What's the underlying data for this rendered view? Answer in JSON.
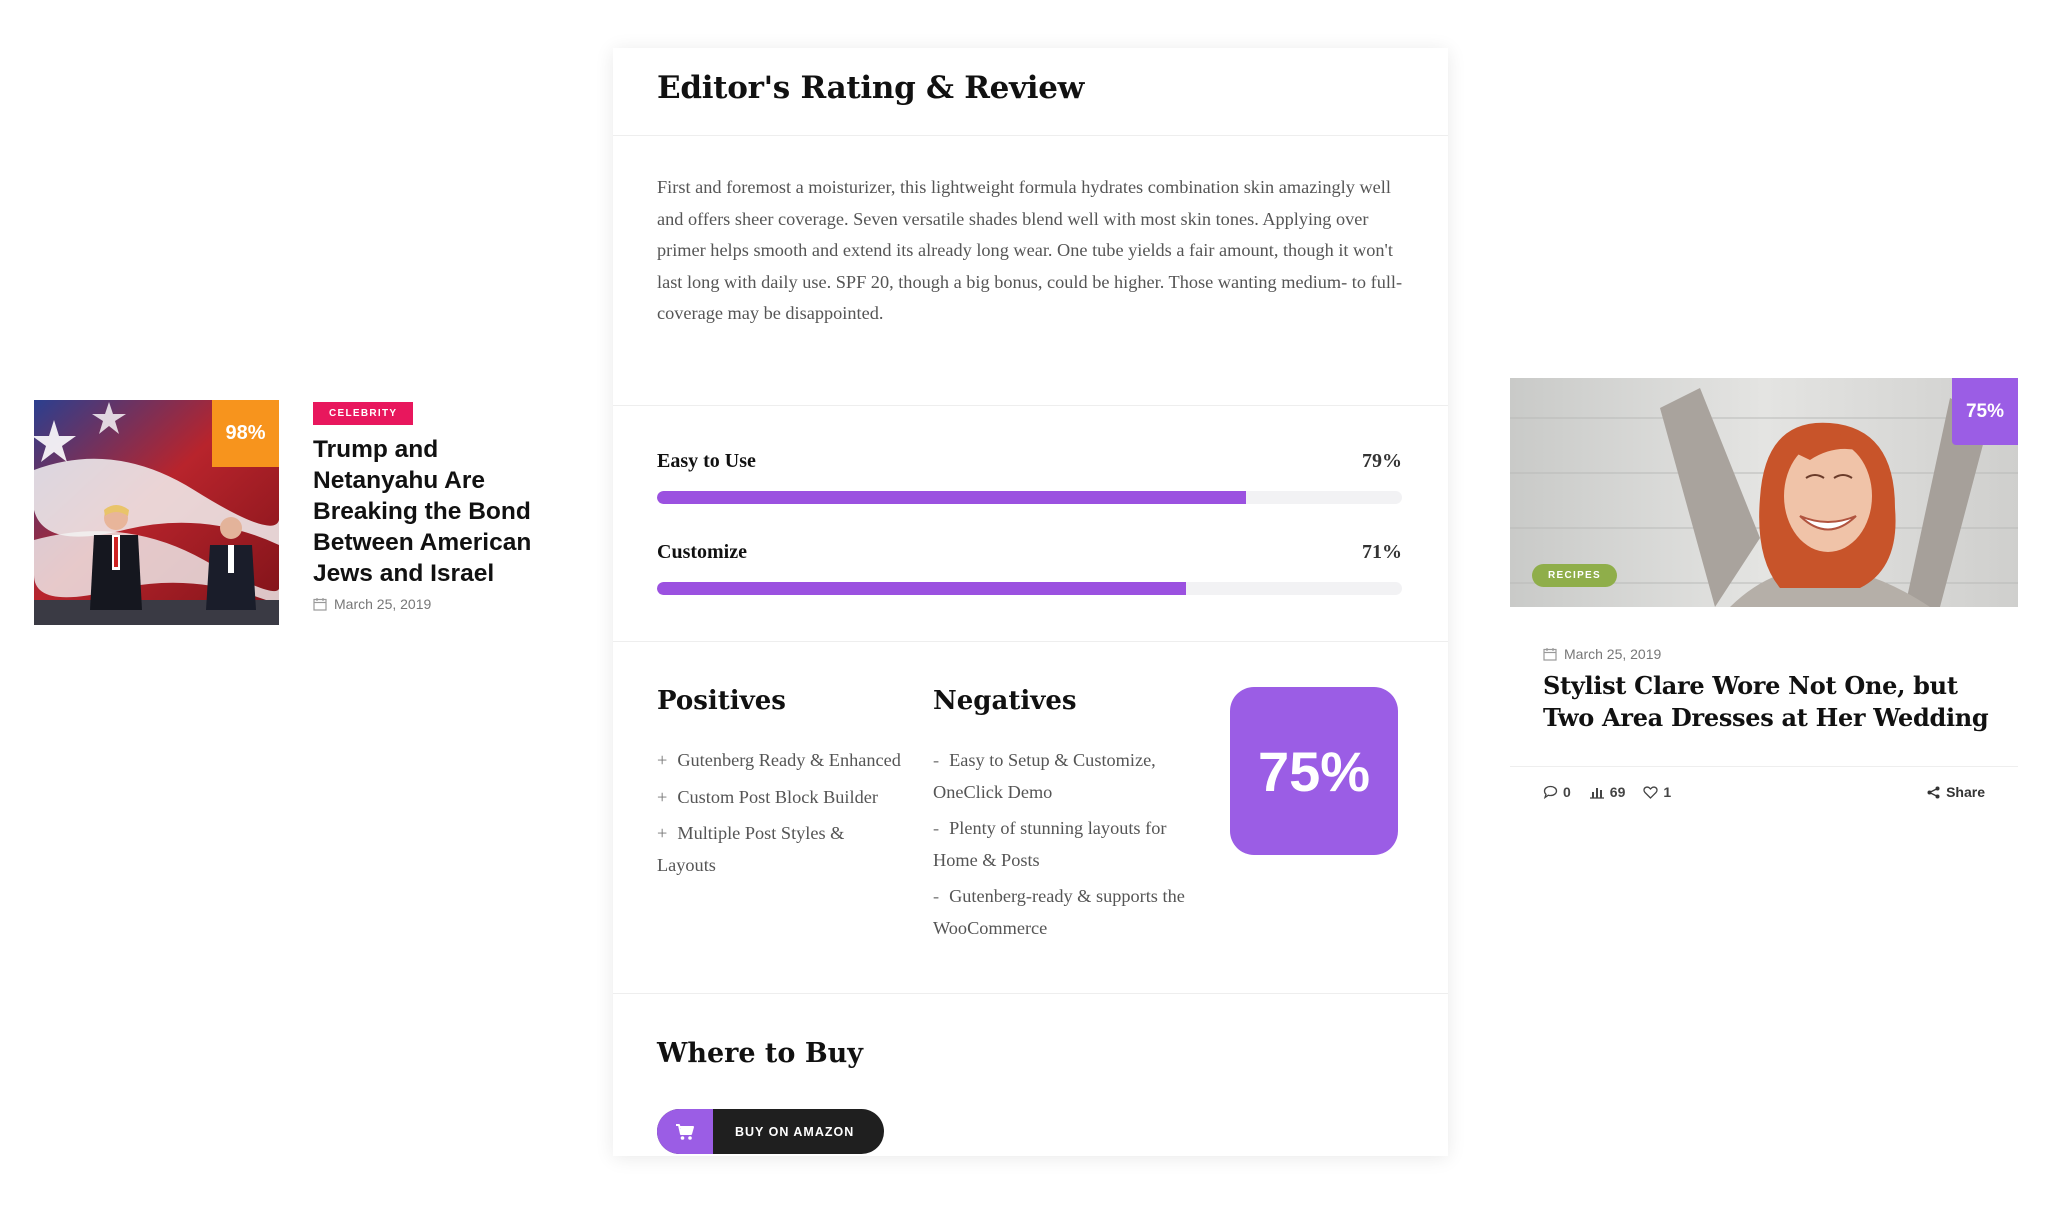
{
  "left_card": {
    "score": "98%",
    "category": "CELEBRITY",
    "title": "Trump and Netanyahu Are Breaking the Bond Between American Jews and Israel",
    "date": "March 25, 2019"
  },
  "review": {
    "title": "Editor's Rating & Review",
    "body": "First and foremost a moisturizer, this lightweight formula hydrates combination skin amazingly well and offers sheer coverage. Seven versatile shades blend well with most skin tones. Applying over primer helps smooth and extend its already long wear. One tube yields a fair amount, though it won't last long with daily use. SPF 20, though a big bonus, could be higher. Those wanting medium- to full-coverage may be disappointed.",
    "ratings": [
      {
        "label": "Easy to Use",
        "value": 79,
        "display": "79%"
      },
      {
        "label": "Customize",
        "value": 71,
        "display": "71%"
      }
    ],
    "positives": {
      "title": "Positives",
      "marker": "+",
      "items": [
        "Gutenberg Ready & Enhanced",
        "Custom Post Block Builder",
        "Multiple Post Styles & Layouts"
      ]
    },
    "negatives": {
      "title": "Negatives",
      "marker": "-",
      "items": [
        "Easy to Setup & Customize, OneClick Demo",
        "Plenty of stunning layouts for Home & Posts",
        "Gutenberg-ready & supports the WooCommerce"
      ]
    },
    "overall_score": "75%",
    "where_to_buy": {
      "title": "Where to Buy",
      "button_label": "BUY ON AMAZON",
      "button_icon": "cart-icon"
    }
  },
  "right_card": {
    "score": "75%",
    "category": "RECIPES",
    "date": "March 25, 2019",
    "title": "Stylist Clare Wore Not One, but Two Area Dresses at Her Wedding",
    "comments": "0",
    "views": "69",
    "likes": "1",
    "share_label": "Share"
  },
  "colors": {
    "accent_purple": "#9b5de5",
    "bar_purple": "#9b51e0",
    "orange": "#f7941d",
    "celebrity_pink": "#e8175d",
    "recipes_green": "#8fae4a"
  }
}
